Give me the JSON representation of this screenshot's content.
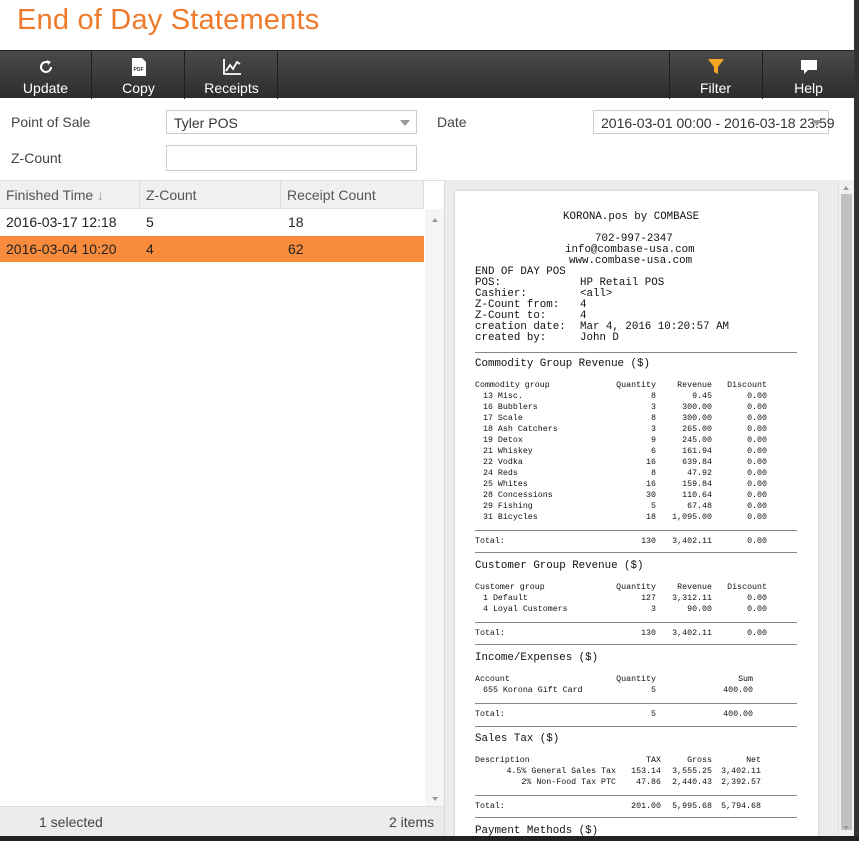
{
  "page": {
    "title": "End of Day Statements"
  },
  "toolbar": {
    "update": "Update",
    "copy": "Copy",
    "receipts": "Receipts",
    "filter": "Filter",
    "help": "Help",
    "pdf_badge": "PDF"
  },
  "filters": {
    "pos_label": "Point of Sale",
    "pos_value": "Tyler POS",
    "date_label": "Date",
    "date_value": "2016-03-01 00:00 - 2016-03-18 23:59",
    "zcount_label": "Z-Count",
    "zcount_value": ""
  },
  "grid": {
    "columns": [
      "Finished Time",
      "Z-Count",
      "Receipt Count"
    ],
    "sort_indicator": "↓",
    "rows": [
      {
        "time": "2016-03-17 12:18",
        "zcount": "5",
        "receipts": "18"
      },
      {
        "time": "2016-03-04 10:20",
        "zcount": "4",
        "receipts": "62"
      }
    ],
    "footer_selected": "1 selected",
    "footer_items": "2 items"
  },
  "colors": {
    "accent": "#ee7a2a",
    "selected_row": "#f98b3c",
    "toolbar": "#3a3a3a"
  },
  "receipt": {
    "company": "KORONA.pos by COMBASE",
    "phone": "702-997-2347",
    "email": "info@combase-usa.com",
    "web": "www.combase-usa.com",
    "heading": "END OF DAY POS",
    "info": [
      {
        "k": "POS:",
        "v": "HP Retail POS"
      },
      {
        "k": "Cashier:",
        "v": "<all>"
      },
      {
        "k": "Z-Count from:",
        "v": "4"
      },
      {
        "k": "Z-Count to:",
        "v": "4"
      },
      {
        "k": "creation date:",
        "v": "Mar 4, 2016 10:20:57 AM"
      },
      {
        "k": "created by:",
        "v": "John D"
      }
    ],
    "commodity": {
      "title": "Commodity Group Revenue ($)",
      "head": [
        "Commodity group",
        "Quantity",
        "Revenue",
        "Discount"
      ],
      "rows": [
        [
          "13 Misc.",
          "8",
          "9.45",
          "0.00"
        ],
        [
          "16 Bubblers",
          "3",
          "300.00",
          "0.00"
        ],
        [
          "17 Scale",
          "8",
          "300.00",
          "0.00"
        ],
        [
          "18 Ash Catchers",
          "3",
          "265.00",
          "0.00"
        ],
        [
          "19 Detox",
          "9",
          "245.00",
          "0.00"
        ],
        [
          "21 Whiskey",
          "6",
          "161.94",
          "0.00"
        ],
        [
          "22 Vodka",
          "16",
          "639.84",
          "0.00"
        ],
        [
          "24 Reds",
          "8",
          "47.92",
          "0.00"
        ],
        [
          "25 Whites",
          "16",
          "159.84",
          "0.00"
        ],
        [
          "28 Concessions",
          "30",
          "110.64",
          "0.00"
        ],
        [
          "29 Fishing",
          "5",
          "67.48",
          "0.00"
        ],
        [
          "31 Bicycles",
          "18",
          "1,095.00",
          "0.00"
        ]
      ],
      "total": [
        "Total:",
        "130",
        "3,402.11",
        "0.00"
      ]
    },
    "customer": {
      "title": "Customer Group Revenue ($)",
      "head": [
        "Customer group",
        "Quantity",
        "Revenue",
        "Discount"
      ],
      "rows": [
        [
          "1 Default",
          "127",
          "3,312.11",
          "0.00"
        ],
        [
          "4 Loyal Customers",
          "3",
          "90.00",
          "0.00"
        ]
      ],
      "total": [
        "Total:",
        "130",
        "3,402.11",
        "0.00"
      ]
    },
    "income": {
      "title": "Income/Expenses ($)",
      "head": [
        "Account",
        "Quantity",
        "Sum"
      ],
      "rows": [
        [
          "655 Korona Gift Card",
          "5",
          "400.00"
        ]
      ],
      "total": [
        "Total:",
        "5",
        "400.00"
      ]
    },
    "tax": {
      "title": "Sales Tax ($)",
      "head": [
        "Description",
        "TAX",
        "Gross",
        "Net"
      ],
      "rows": [
        [
          "4.5% General Sales Tax",
          "153.14",
          "3,555.25",
          "3,402.11"
        ],
        [
          "2% Non-Food Tax PTC",
          "47.86",
          "2,440.43",
          "2,392.57"
        ]
      ],
      "total": [
        "Total:",
        "201.00",
        "5,995.68",
        "5,794.68"
      ]
    },
    "payment_title": "Payment Methods ($)"
  }
}
